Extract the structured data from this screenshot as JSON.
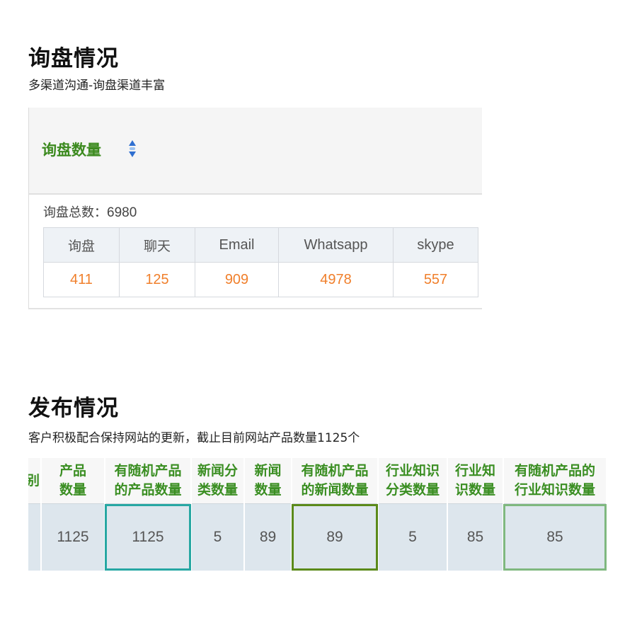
{
  "inquiry_section": {
    "title": "询盘情况",
    "subtitle": "多渠道沟通-询盘渠道丰富",
    "panel_title": "询盘数量",
    "total_label": "询盘总数：",
    "total_value": "6980",
    "channels": [
      {
        "name": "询盘",
        "count": "411"
      },
      {
        "name": "聊天",
        "count": "125"
      },
      {
        "name": "Email",
        "count": "909"
      },
      {
        "name": "Whatsapp",
        "count": "4978"
      },
      {
        "name": "skype",
        "count": "557"
      }
    ]
  },
  "publish_section": {
    "title": "发布情况",
    "subtitle": "客户积极配合保持网站的更新，截止目前网站产品数量1125个",
    "partial_col": "别",
    "columns": [
      {
        "l1": "产品",
        "l2": "数量",
        "value": "1125"
      },
      {
        "l1": "有随机产品",
        "l2": "的产品数量",
        "value": "1125"
      },
      {
        "l1": "新闻分",
        "l2": "类数量",
        "value": "5"
      },
      {
        "l1": "新闻",
        "l2": "数量",
        "value": "89"
      },
      {
        "l1": "有随机产品",
        "l2": "的新闻数量",
        "value": "89"
      },
      {
        "l1": "行业知识",
        "l2": "分类数量",
        "value": "5"
      },
      {
        "l1": "行业知",
        "l2": "识数量",
        "value": "85"
      },
      {
        "l1": "有随机产品的",
        "l2": "行业知识数量",
        "value": "85"
      }
    ]
  },
  "colors": {
    "green_title": "#3c8a1f",
    "orange_value": "#f07f2b",
    "highlight_teal": "#27a7a3",
    "highlight_olive": "#5b8a1a",
    "highlight_light_green": "#7fb87f"
  },
  "icons": {
    "sort": "sort-updown-icon"
  }
}
